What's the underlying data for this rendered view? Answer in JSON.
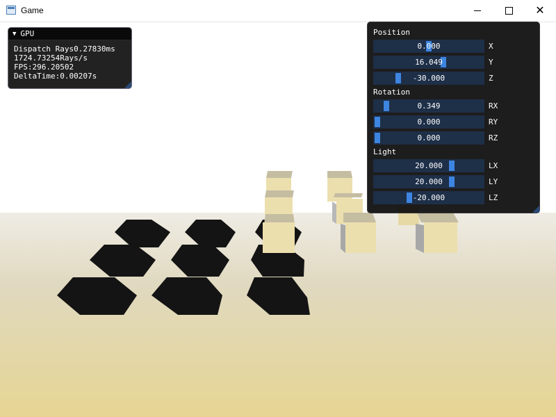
{
  "window": {
    "title": "Game"
  },
  "gpu_panel": {
    "title": "GPU",
    "lines": [
      "Dispatch Rays0.27830ms",
      "1724.73254Rays/s",
      "FPS:296.20502",
      "DeltaTime:0.00207s"
    ]
  },
  "transform_panel": {
    "position_label": "Position",
    "rotation_label": "Rotation",
    "light_label": "Light",
    "position": [
      {
        "value": "0.000",
        "axis": "X",
        "level": 0.5
      },
      {
        "value": "16.049",
        "axis": "Y",
        "level": 0.64
      },
      {
        "value": "-30.000",
        "axis": "Z",
        "level": 0.2
      }
    ],
    "rotation": [
      {
        "value": "0.349",
        "axis": "RX",
        "level": 0.09
      },
      {
        "value": "0.000",
        "axis": "RY",
        "level": 0.0
      },
      {
        "value": "0.000",
        "axis": "RZ",
        "level": 0.0
      }
    ],
    "light": [
      {
        "value": "20.000",
        "axis": "LX",
        "level": 0.72
      },
      {
        "value": "20.000",
        "axis": "LY",
        "level": 0.72
      },
      {
        "value": "-20.000",
        "axis": "LZ",
        "level": 0.31
      }
    ]
  }
}
